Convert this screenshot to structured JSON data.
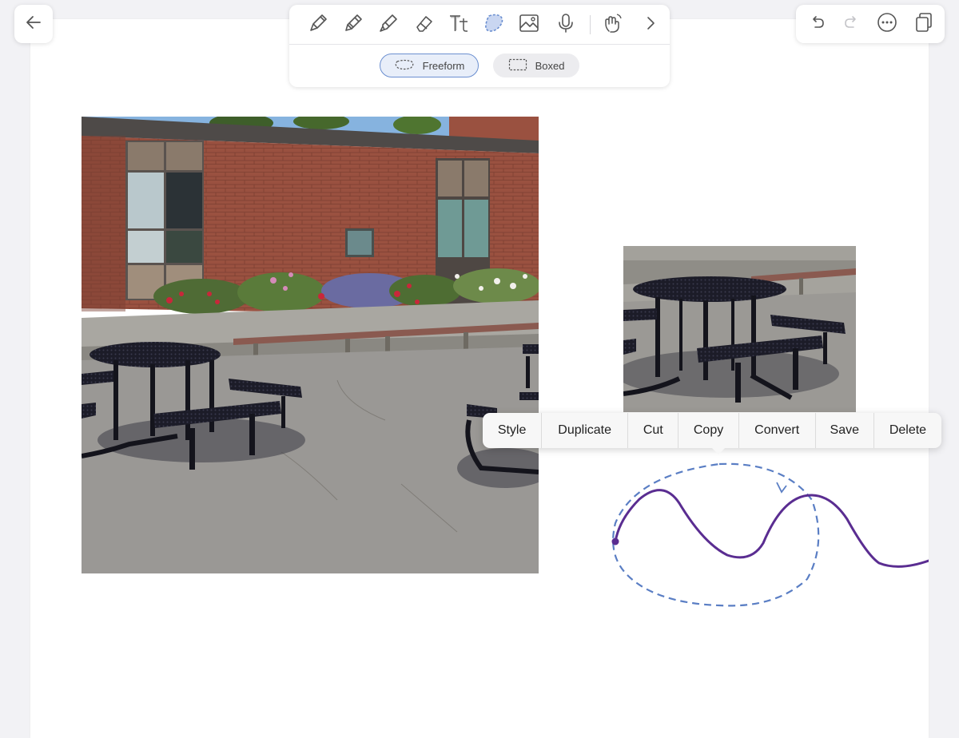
{
  "colors": {
    "accent": "#6b8fd0",
    "ink": "#5a2d91",
    "lasso": "#5a7ec4",
    "icon": "#555555"
  },
  "header": {
    "back_icon": "arrow-left-icon"
  },
  "toolbar": {
    "tools": [
      {
        "name": "fountain-pen-icon"
      },
      {
        "name": "pencil-icon"
      },
      {
        "name": "highlighter-icon"
      },
      {
        "name": "eraser-icon"
      },
      {
        "name": "text-tool-icon"
      },
      {
        "name": "lasso-tool-icon",
        "selected": true
      },
      {
        "name": "image-tool-icon"
      },
      {
        "name": "microphone-icon"
      },
      {
        "name": "touch-gesture-icon"
      },
      {
        "name": "chevron-right-icon"
      }
    ],
    "modes": {
      "freeform": "Freeform",
      "boxed": "Boxed"
    },
    "selected_mode": "Freeform"
  },
  "right_toolbar": {
    "tools": [
      {
        "name": "undo-icon"
      },
      {
        "name": "redo-icon",
        "disabled": true
      },
      {
        "name": "more-options-icon"
      },
      {
        "name": "pages-icon"
      }
    ]
  },
  "context_menu": {
    "items": [
      "Style",
      "Duplicate",
      "Cut",
      "Copy",
      "Convert",
      "Save",
      "Delete"
    ]
  }
}
